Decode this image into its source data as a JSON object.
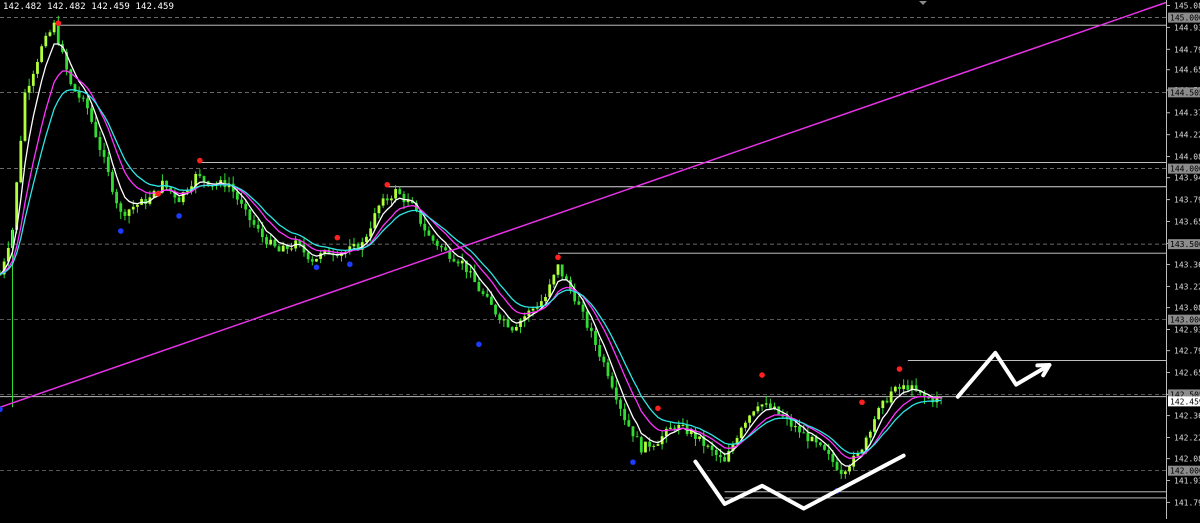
{
  "header": {
    "ohlc": "142.482 142.482 142.459 142.459"
  },
  "colors": {
    "background": "#000000",
    "candle": "#32dc32",
    "candle_hi": "#b4ff3c",
    "ma_fast": "#ffffff",
    "ma_mid": "#ff33ff",
    "ma_slow": "#2ee6e6",
    "trendline": "#e633e6",
    "fractal_up": "#ff2020",
    "fractal_down": "#1e3cff",
    "level_solid": "#d8d8d8",
    "level_dashed": "#8a8a8a",
    "annotation": "#ffffff",
    "axis_text": "#dddddd",
    "axis_tag_bg": "#8c8c8c",
    "price_tag_bg": "#ffffff"
  },
  "chart_data": {
    "type": "candlestick",
    "ylim": [
      141.72,
      145.09
    ],
    "x_count": 280,
    "y_ticks": [
      "145.080",
      "144.935",
      "144.790",
      "144.655",
      "144.520",
      "144.370",
      "144.225",
      "144.080",
      "143.940",
      "143.795",
      "143.650",
      "143.505",
      "143.365",
      "143.220",
      "143.080",
      "142.935",
      "142.795",
      "142.650",
      "142.505",
      "142.365",
      "142.220",
      "142.080",
      "141.935",
      "141.790"
    ],
    "tagged_levels": [
      "145.000",
      "144.505",
      "144.000",
      "143.500",
      "143.000",
      "142.505",
      "142.000"
    ],
    "current_price": "142.459",
    "horizontal_levels": [
      {
        "price": 144.95,
        "x_start": 14
      },
      {
        "price": 144.04,
        "x_start": 48
      },
      {
        "price": 143.88,
        "x_start": 93
      },
      {
        "price": 143.44,
        "x_start": 134
      },
      {
        "price": 142.73,
        "x_start": 218
      },
      {
        "price": 142.49,
        "x_start": 0
      },
      {
        "price": 141.86,
        "x_start": 174
      },
      {
        "price": 141.82,
        "x_start": 174
      }
    ],
    "dashed_levels": [
      145.0,
      144.505,
      144.0,
      143.5,
      143.0,
      142.505,
      142.0
    ],
    "trendline": {
      "x1": 0,
      "y1": 142.42,
      "x2": 280,
      "y2": 145.1
    },
    "price_path": [
      [
        0,
        143.3
      ],
      [
        3,
        143.6
      ],
      [
        6,
        144.5
      ],
      [
        10,
        144.8
      ],
      [
        13,
        144.95
      ],
      [
        17,
        144.55
      ],
      [
        21,
        144.4
      ],
      [
        25,
        144.05
      ],
      [
        29,
        143.7
      ],
      [
        32,
        143.75
      ],
      [
        36,
        143.8
      ],
      [
        39,
        143.9
      ],
      [
        43,
        143.8
      ],
      [
        47,
        143.95
      ],
      [
        51,
        143.9
      ],
      [
        55,
        143.9
      ],
      [
        59,
        143.7
      ],
      [
        63,
        143.55
      ],
      [
        67,
        143.45
      ],
      [
        71,
        143.5
      ],
      [
        75,
        143.4
      ],
      [
        79,
        143.45
      ],
      [
        83,
        143.45
      ],
      [
        87,
        143.5
      ],
      [
        91,
        143.75
      ],
      [
        95,
        143.85
      ],
      [
        99,
        143.75
      ],
      [
        103,
        143.55
      ],
      [
        107,
        143.45
      ],
      [
        111,
        143.38
      ],
      [
        115,
        143.2
      ],
      [
        119,
        143.05
      ],
      [
        123,
        142.95
      ],
      [
        127,
        143.05
      ],
      [
        131,
        143.15
      ],
      [
        134,
        143.35
      ],
      [
        138,
        143.15
      ],
      [
        142,
        142.9
      ],
      [
        146,
        142.65
      ],
      [
        150,
        142.35
      ],
      [
        154,
        142.15
      ],
      [
        158,
        142.2
      ],
      [
        162,
        142.3
      ],
      [
        166,
        142.25
      ],
      [
        170,
        142.15
      ],
      [
        174,
        142.05
      ],
      [
        178,
        142.3
      ],
      [
        182,
        142.45
      ],
      [
        186,
        142.4
      ],
      [
        190,
        142.3
      ],
      [
        194,
        142.22
      ],
      [
        198,
        142.12
      ],
      [
        202,
        142.0
      ],
      [
        206,
        142.1
      ],
      [
        210,
        142.35
      ],
      [
        214,
        142.52
      ],
      [
        218,
        142.56
      ],
      [
        222,
        142.48
      ],
      [
        226,
        142.47
      ]
    ],
    "fractals_up": [
      [
        14,
        144.95
      ],
      [
        38,
        143.82
      ],
      [
        48,
        144.04
      ],
      [
        81,
        143.53
      ],
      [
        93,
        143.88
      ],
      [
        134,
        143.4
      ],
      [
        158,
        142.4
      ],
      [
        183,
        142.62
      ],
      [
        207,
        142.44
      ],
      [
        216,
        142.66
      ]
    ],
    "fractals_down": [
      [
        29,
        143.6
      ],
      [
        43,
        143.7
      ],
      [
        76,
        143.36
      ],
      [
        84,
        143.38
      ],
      [
        115,
        142.85
      ],
      [
        152,
        142.07
      ],
      [
        201,
        141.88
      ],
      [
        0,
        142.42
      ]
    ],
    "annotations": [
      {
        "name": "zigzag-up-arrow",
        "points": [
          [
            230,
            142.49
          ],
          [
            239,
            142.78
          ],
          [
            244,
            142.57
          ],
          [
            252,
            142.7
          ]
        ],
        "arrow": true
      },
      {
        "name": "w-shape-mark",
        "points": [
          [
            167,
            142.06
          ],
          [
            174,
            141.78
          ],
          [
            183,
            141.9
          ],
          [
            193,
            141.75
          ],
          [
            217,
            142.1
          ]
        ],
        "arrow": false
      }
    ]
  }
}
